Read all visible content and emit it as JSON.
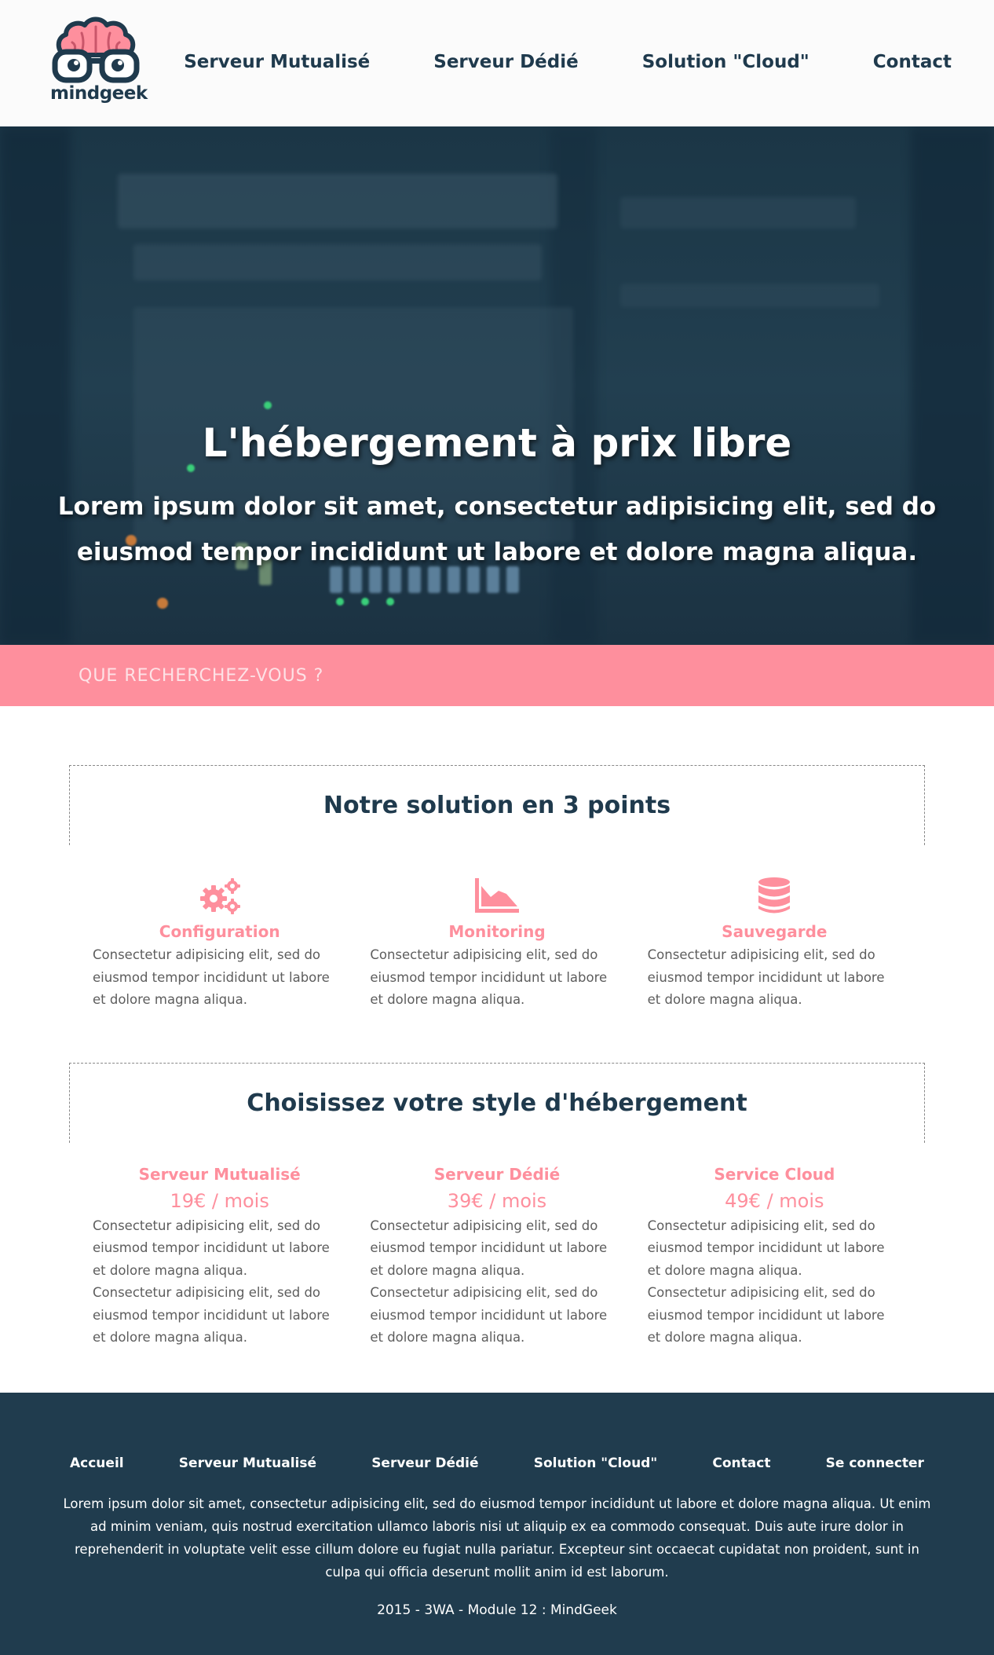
{
  "brand": {
    "name": "mindgeek",
    "accent": "#fe8f9d",
    "dark": "#1f3a4d"
  },
  "nav": [
    {
      "label": "Serveur Mutualisé"
    },
    {
      "label": "Serveur Dédié"
    },
    {
      "label": "Solution \"Cloud\""
    },
    {
      "label": "Contact"
    }
  ],
  "hero": {
    "title": "L'hébergement à prix libre",
    "subtitle": "Lorem ipsum dolor sit amet, consectetur adipisicing elit, sed do eiusmod tempor incididunt ut labore et dolore magna aliqua."
  },
  "search": {
    "placeholder": "QUE RECHERCHEZ-VOUS ?"
  },
  "features": {
    "title": "Notre solution en 3 points",
    "items": [
      {
        "icon": "gears-icon",
        "title": "Configuration",
        "text": "Consectetur adipisicing elit, sed do eiusmod tempor incididunt ut labore et dolore magna aliqua."
      },
      {
        "icon": "area-chart-icon",
        "title": "Monitoring",
        "text": "Consectetur adipisicing elit, sed do eiusmod tempor incididunt ut labore et dolore magna aliqua."
      },
      {
        "icon": "database-icon",
        "title": "Sauvegarde",
        "text": "Consectetur adipisicing elit, sed do eiusmod tempor incididunt ut labore et dolore magna aliqua."
      }
    ]
  },
  "plans": {
    "title": "Choisissez votre style d'hébergement",
    "items": [
      {
        "title": "Serveur Mutualisé",
        "price": "19€ / mois",
        "text1": "Consectetur adipisicing elit, sed do eiusmod tempor incididunt ut labore et dolore magna aliqua.",
        "text2": "Consectetur adipisicing elit, sed do eiusmod tempor incididunt ut labore et dolore magna aliqua."
      },
      {
        "title": "Serveur Dédié",
        "price": "39€ / mois",
        "text1": "Consectetur adipisicing elit, sed do eiusmod tempor incididunt ut labore et dolore magna aliqua.",
        "text2": "Consectetur adipisicing elit, sed do eiusmod tempor incididunt ut labore et dolore magna aliqua."
      },
      {
        "title": "Service Cloud",
        "price": "49€ / mois",
        "text1": "Consectetur adipisicing elit, sed do eiusmod tempor incididunt ut labore et dolore magna aliqua.",
        "text2": "Consectetur adipisicing elit, sed do eiusmod tempor incididunt ut labore et dolore magna aliqua."
      }
    ]
  },
  "footer": {
    "nav": [
      {
        "label": "Accueil"
      },
      {
        "label": "Serveur Mutualisé"
      },
      {
        "label": "Serveur Dédié"
      },
      {
        "label": "Solution \"Cloud\""
      },
      {
        "label": "Contact"
      },
      {
        "label": "Se connecter"
      }
    ],
    "text": "Lorem ipsum dolor sit amet, consectetur adipisicing elit, sed do eiusmod tempor incididunt ut labore et dolore magna aliqua. Ut enim ad minim veniam, quis nostrud exercitation ullamco laboris nisi ut aliquip ex ea commodo consequat. Duis aute irure dolor in reprehenderit in voluptate velit esse cillum dolore eu fugiat nulla pariatur. Excepteur sint occaecat cupidatat non proident, sunt in culpa qui officia deserunt mollit anim id est laborum.",
    "copyright": "2015 - 3WA - Module 12 : MindGeek"
  }
}
